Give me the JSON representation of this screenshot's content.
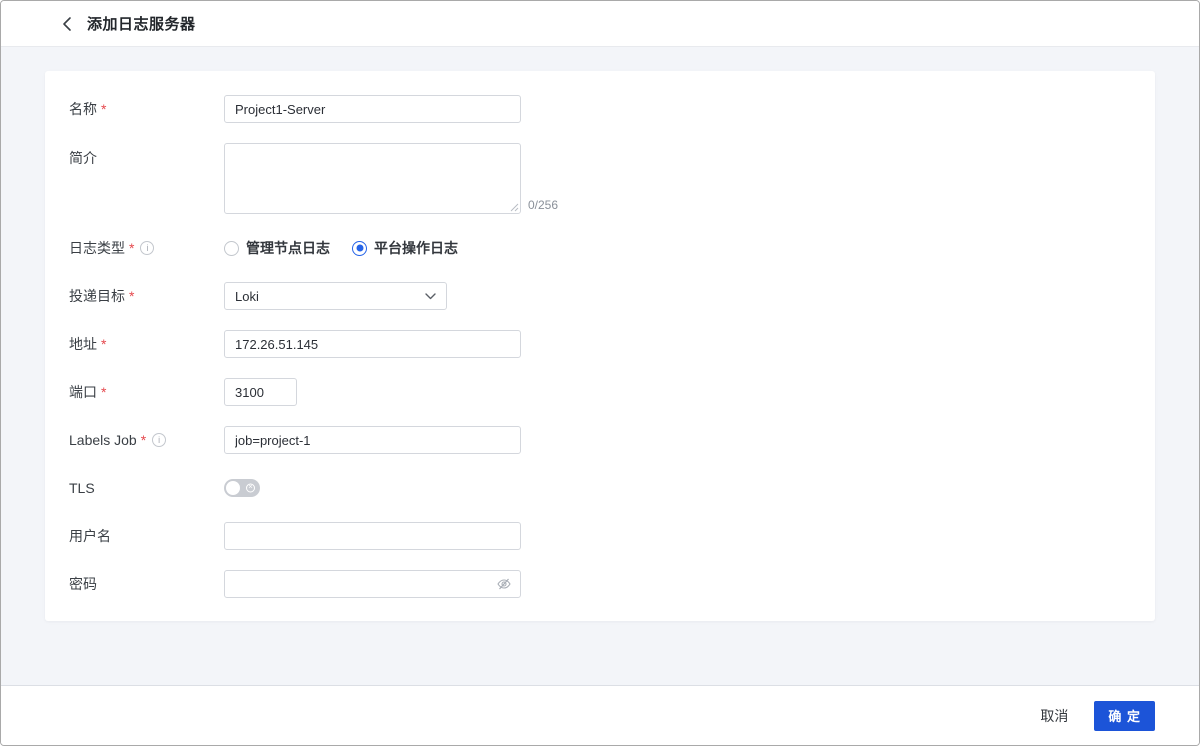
{
  "header": {
    "title": "添加日志服务器"
  },
  "colors": {
    "accent": "#1c54d8",
    "required_red": "#e5484d",
    "toggle_off": "#c9ccd2"
  },
  "form": {
    "name": {
      "label": "名称",
      "value": "Project1-Server"
    },
    "desc": {
      "label": "简介",
      "value": "",
      "counter": "0/256"
    },
    "log_type": {
      "label": "日志类型",
      "options": [
        {
          "label": "管理节点日志",
          "selected": false
        },
        {
          "label": "平台操作日志",
          "selected": true
        }
      ]
    },
    "target": {
      "label": "投递目标",
      "value": "Loki"
    },
    "address": {
      "label": "地址",
      "value": "172.26.51.145"
    },
    "port": {
      "label": "端口",
      "value": "3100"
    },
    "labels_job": {
      "label": "Labels Job",
      "value": "job=project-1"
    },
    "tls": {
      "label": "TLS",
      "state": "off"
    },
    "username": {
      "label": "用户名",
      "value": ""
    },
    "password": {
      "label": "密码",
      "value": ""
    }
  },
  "footer": {
    "cancel_label": "取消",
    "confirm_label": "确 定"
  }
}
